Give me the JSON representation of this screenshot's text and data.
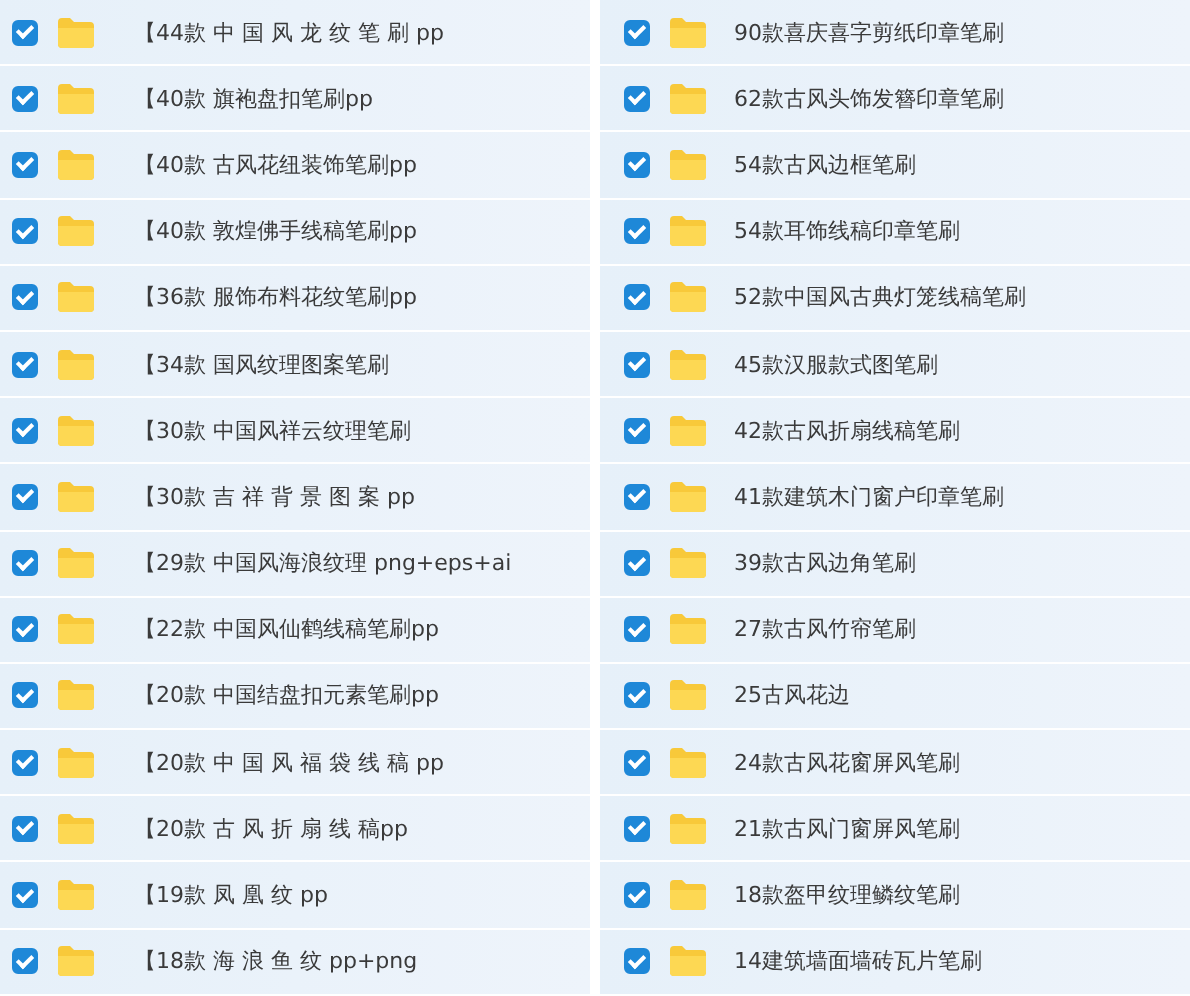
{
  "columns": [
    {
      "items": [
        {
          "name": "【44款 中 国 风 龙 纹 笔 刷 pp",
          "checked": true
        },
        {
          "name": "【40款 旗袍盘扣笔刷pp",
          "checked": true
        },
        {
          "name": "【40款 古风花纽装饰笔刷pp",
          "checked": true
        },
        {
          "name": "【40款 敦煌佛手线稿笔刷pp",
          "checked": true
        },
        {
          "name": "【36款 服饰布料花纹笔刷pp",
          "checked": true
        },
        {
          "name": "【34款 国风纹理图案笔刷",
          "checked": true
        },
        {
          "name": "【30款 中国风祥云纹理笔刷",
          "checked": true
        },
        {
          "name": "【30款 吉 祥 背 景 图 案 pp",
          "checked": true
        },
        {
          "name": "【29款 中国风海浪纹理 png+eps+ai",
          "checked": true
        },
        {
          "name": "【22款 中国风仙鹤线稿笔刷pp",
          "checked": true
        },
        {
          "name": "【20款 中国结盘扣元素笔刷pp",
          "checked": true
        },
        {
          "name": "【20款 中 国 风 福 袋 线 稿 pp",
          "checked": true
        },
        {
          "name": "【20款 古 风 折 扇 线 稿pp",
          "checked": true
        },
        {
          "name": "【19款 凤 凰 纹 pp",
          "checked": true
        },
        {
          "name": "【18款 海 浪 鱼 纹 pp+png",
          "checked": true
        }
      ]
    },
    {
      "items": [
        {
          "name": "90款喜庆喜字剪纸印章笔刷",
          "checked": true
        },
        {
          "name": "62款古风头饰发簪印章笔刷",
          "checked": true
        },
        {
          "name": "54款古风边框笔刷",
          "checked": true
        },
        {
          "name": "54款耳饰线稿印章笔刷",
          "checked": true
        },
        {
          "name": "52款中国风古典灯笼线稿笔刷",
          "checked": true
        },
        {
          "name": "45款汉服款式图笔刷",
          "checked": true
        },
        {
          "name": "42款古风折扇线稿笔刷",
          "checked": true
        },
        {
          "name": "41款建筑木门窗户印章笔刷",
          "checked": true
        },
        {
          "name": "39款古风边角笔刷",
          "checked": true
        },
        {
          "name": "27款古风竹帘笔刷",
          "checked": true
        },
        {
          "name": "25古风花边",
          "checked": true
        },
        {
          "name": "24款古风花窗屏风笔刷",
          "checked": true
        },
        {
          "name": "21款古风门窗屏风笔刷",
          "checked": true
        },
        {
          "name": "18款盔甲纹理鳞纹笔刷",
          "checked": true
        },
        {
          "name": "14建筑墙面墙砖瓦片笔刷",
          "checked": true
        }
      ]
    }
  ]
}
